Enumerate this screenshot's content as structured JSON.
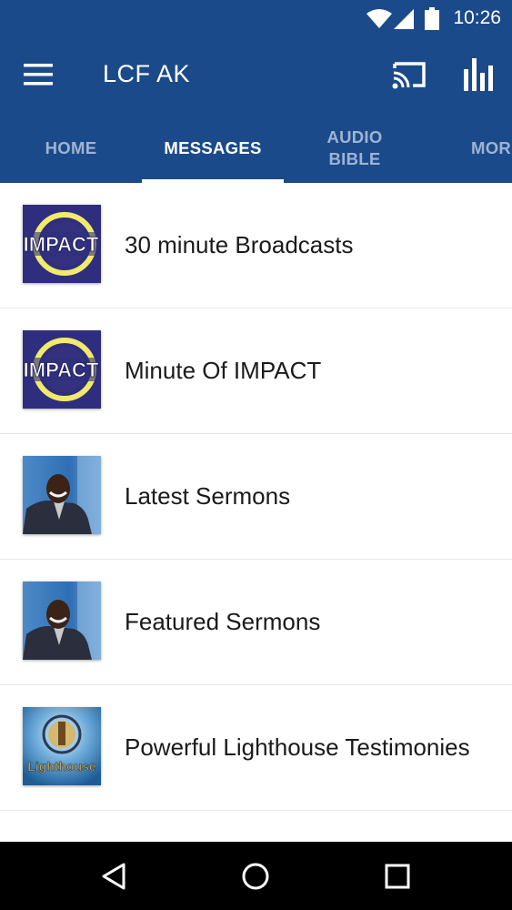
{
  "status_bar": {
    "time": "10:26",
    "icons": [
      "wifi-icon",
      "cell-signal-icon",
      "battery-icon"
    ]
  },
  "app_bar": {
    "title": "LCF AK",
    "icons": [
      "menu-icon",
      "cast-icon",
      "equalizer-icon"
    ]
  },
  "tabs": [
    {
      "label": "HOME",
      "active": false
    },
    {
      "label": "MESSAGES",
      "active": true
    },
    {
      "label": "AUDIO\nBIBLE",
      "active": false
    },
    {
      "label": "MORE",
      "active": false
    }
  ],
  "list": {
    "items": [
      {
        "title": "30 minute Broadcasts",
        "thumb": "impact-logo",
        "thumb_text": "IMPACT"
      },
      {
        "title": "Minute Of IMPACT",
        "thumb": "impact-logo",
        "thumb_text": "IMPACT"
      },
      {
        "title": "Latest Sermons",
        "thumb": "preacher-photo"
      },
      {
        "title": "Featured Sermons",
        "thumb": "preacher-photo"
      },
      {
        "title": "Powerful Lighthouse Testimonies",
        "thumb": "lighthouse-logo",
        "thumb_text": "Lighthouse"
      }
    ]
  },
  "nav_bar": {
    "icons": [
      "back-icon",
      "home-icon",
      "recents-icon"
    ]
  },
  "colors": {
    "primary": "#1b4a8a",
    "tab_inactive": "#9fb3d4",
    "text": "#1a1a1a"
  }
}
